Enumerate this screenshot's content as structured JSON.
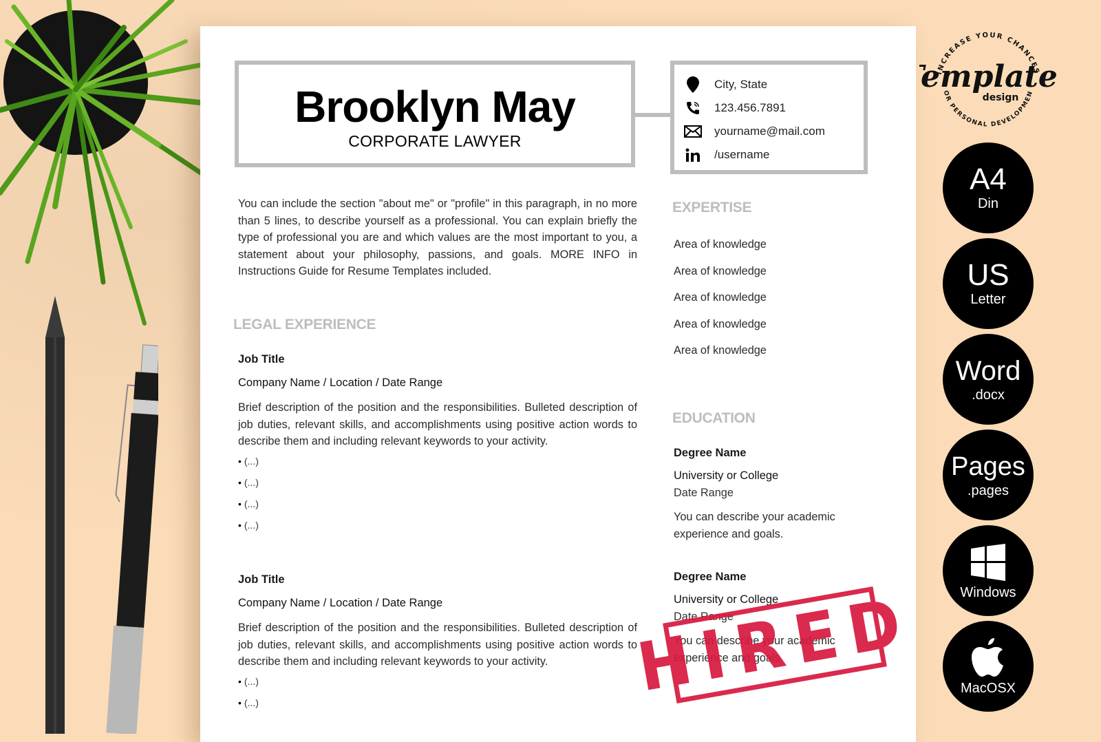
{
  "resume": {
    "name": "Brooklyn May",
    "role": "CORPORATE LAWYER",
    "contact": [
      {
        "icon": "map-pin-icon",
        "text": "City, State"
      },
      {
        "icon": "phone-icon",
        "text": "123.456.7891"
      },
      {
        "icon": "envelope-icon",
        "text": "yourname@mail.com"
      },
      {
        "icon": "linkedin-icon",
        "text": "/username"
      }
    ],
    "profile": "You can include the section \"about me\" or \"profile\" in this paragraph, in no more than 5 lines, to describe yourself as a professional. You can explain briefly the type of professional you are and which values are the most important to you, a statement about your philosophy, passions, and goals. MORE INFO in Instructions Guide for Resume Templates included.",
    "experience_title": "LEGAL EXPERIENCE",
    "jobs": [
      {
        "title": "Job Title",
        "company": "Company Name / Location / Date Range",
        "description": "Brief description of the position and the responsibilities. Bulleted description of job duties, relevant skills, and accomplishments using positive action words to describe them and including relevant keywords to your activity.",
        "bullets": [
          "(...)",
          "(...)",
          "(...)",
          "(...)"
        ]
      },
      {
        "title": "Job Title",
        "company": "Company Name / Location / Date Range",
        "description": "Brief description of the position and the responsibilities. Bulleted description of job duties, relevant skills, and accomplishments using positive action words to describe them and including relevant keywords to your activity.",
        "bullets": [
          "(...)",
          "(...)"
        ]
      }
    ],
    "expertise_title": "EXPERTISE",
    "expertise": [
      "Area of knowledge",
      "Area of knowledge",
      "Area of knowledge",
      "Area of knowledge",
      "Area of knowledge"
    ],
    "education_title": "EDUCATION",
    "education": [
      {
        "degree": "Degree Name",
        "school": "University or College",
        "date": "Date Range",
        "description": "You can describe your academic experience and goals."
      },
      {
        "degree": "Degree Name",
        "school": "University or College",
        "date": "Date Range",
        "description": "You can describe your academic experience and goals."
      }
    ],
    "stamp": "HIRED"
  },
  "logo": {
    "arc_top": "INCREASE YOUR CHANCES",
    "script": "Templates",
    "sub": "design",
    "arc_bottom": "FOR PERSONAL DEVELOPMENT"
  },
  "badges": [
    {
      "big": "A4",
      "small": "Din"
    },
    {
      "big": "US",
      "small": "Letter"
    },
    {
      "big": "Word",
      "small": ".docx"
    },
    {
      "big": "Pages",
      "small": ".pages"
    },
    {
      "icon": "windows-logo-icon",
      "small": "Windows"
    },
    {
      "icon": "apple-logo-icon",
      "small": "MacOSX"
    }
  ],
  "colors": {
    "background": "#fcdcb8",
    "frame_gray": "#bdbdbd",
    "stamp_red": "#d7193f",
    "badge_black": "#000000"
  }
}
